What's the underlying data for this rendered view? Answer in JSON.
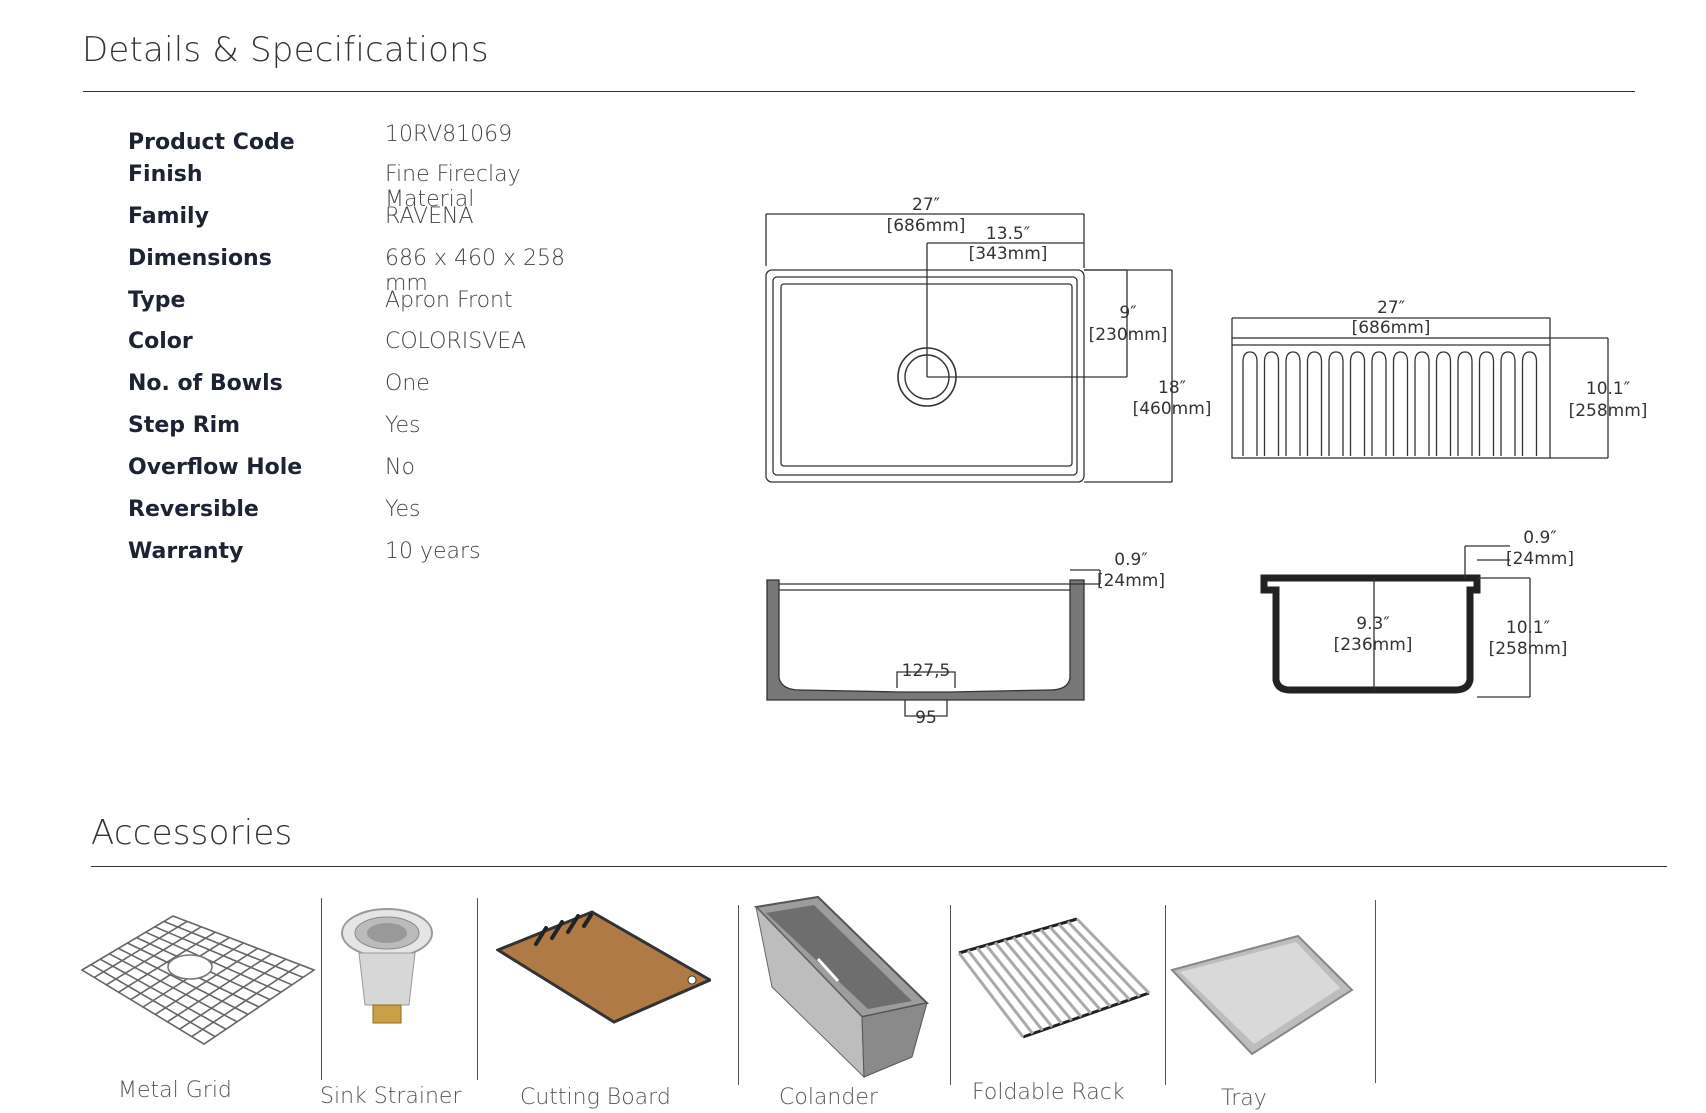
{
  "details": {
    "title": "Details & Specifications",
    "specs": [
      {
        "label": "Product Code",
        "value": "10RV81069"
      },
      {
        "label": "Finish",
        "value": "Fine Fireclay Material"
      },
      {
        "label": "Family",
        "value": "RAVENA"
      },
      {
        "label": "Dimensions",
        "value": "686 x 460 x 258 mm"
      },
      {
        "label": "Type",
        "value": "Apron Front"
      },
      {
        "label": "Color",
        "value": "COLORISVEA"
      },
      {
        "label": "No. of Bowls",
        "value": "One"
      },
      {
        "label": "Step Rim",
        "value": "Yes"
      },
      {
        "label": "Overflow Hole",
        "value": "No"
      },
      {
        "label": "Reversible",
        "value": "Yes"
      },
      {
        "label": "Warranty",
        "value": "10 years"
      }
    ]
  },
  "drawings": {
    "top_view": {
      "width_in": "27″",
      "width_mm": "[686mm]",
      "drain_in": "13.5″",
      "drain_mm": "[343mm]",
      "drain_depth_in": "9″",
      "drain_depth_mm": "[230mm]",
      "depth_in": "18″",
      "depth_mm": "[460mm]"
    },
    "front_view": {
      "width_in": "27″",
      "width_mm": "[686mm]",
      "height_in": "10.1″",
      "height_mm": "[258mm]"
    },
    "section_long": {
      "rim_in": "0.9″",
      "rim_mm": "[24mm]",
      "drain_top": "127,5",
      "drain_bottom": "95"
    },
    "section_short": {
      "rim_in": "0.9″",
      "rim_mm": "[24mm]",
      "inner_in": "9.3″",
      "inner_mm": "[236mm]",
      "height_in": "10.1″",
      "height_mm": "[258mm]"
    }
  },
  "accessories": {
    "title": "Accessories",
    "items": [
      {
        "label": "Metal Grid",
        "icon": "metal-grid-icon"
      },
      {
        "label": "Sink Strainer",
        "icon": "sink-strainer-icon"
      },
      {
        "label": "Cutting Board",
        "icon": "cutting-board-icon"
      },
      {
        "label": "Colander",
        "icon": "colander-icon"
      },
      {
        "label": "Foldable Rack",
        "icon": "foldable-rack-icon"
      },
      {
        "label": "Tray",
        "icon": "tray-icon"
      }
    ]
  }
}
